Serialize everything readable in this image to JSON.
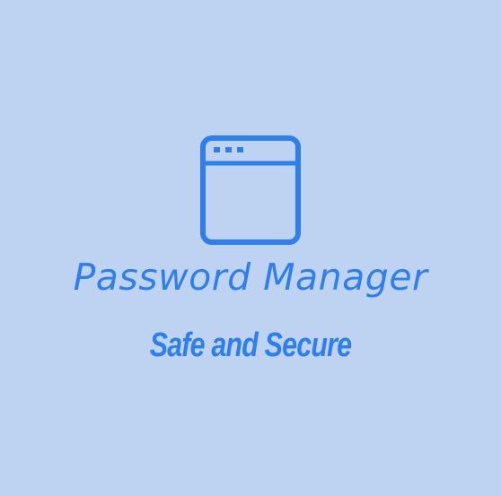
{
  "logo": {
    "icon": "browser-window-icon",
    "title": "Password Manager",
    "tagline": "Safe and Secure",
    "colors": {
      "background": "#bed3f1",
      "accent": "#2d7ff0"
    }
  }
}
